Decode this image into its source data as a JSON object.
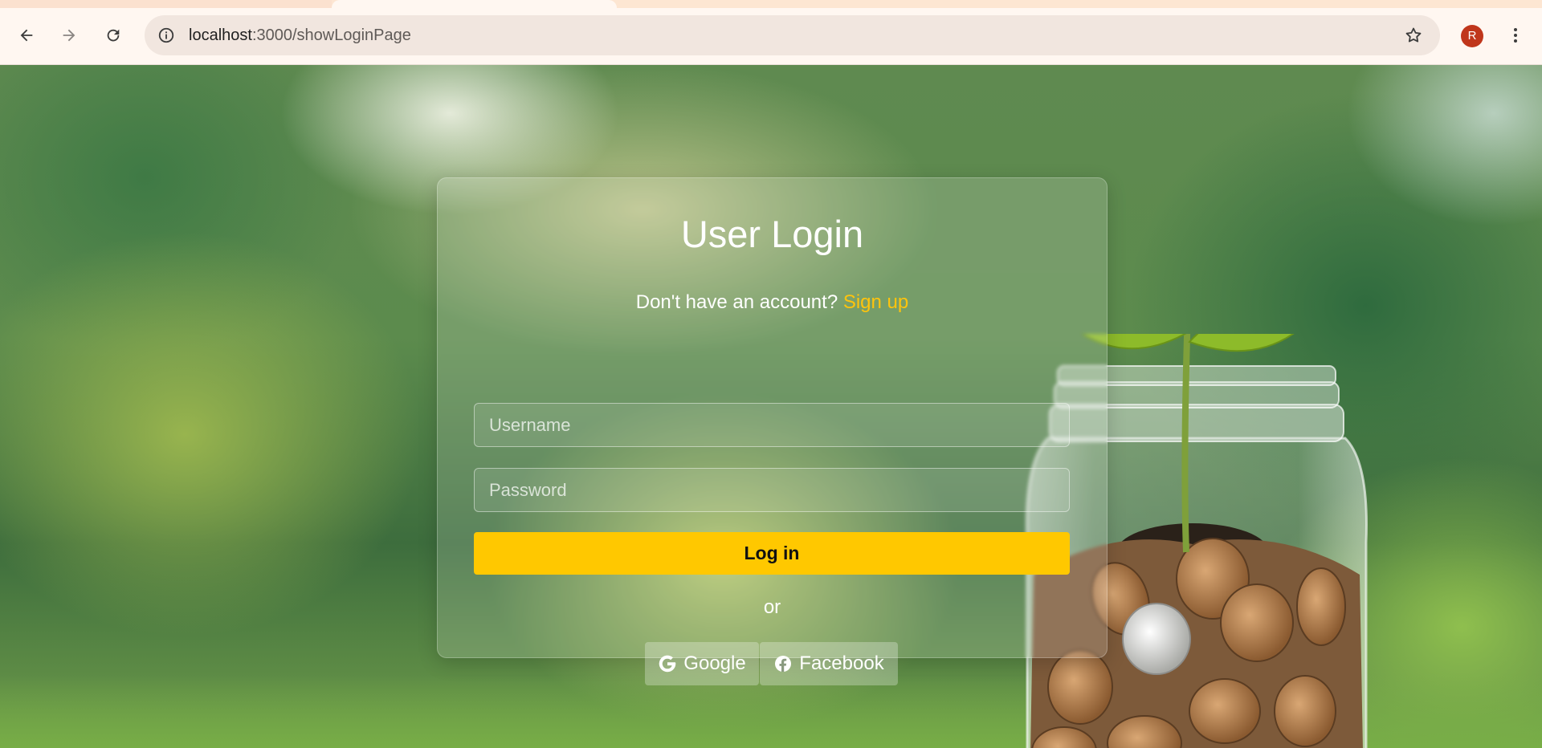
{
  "browser": {
    "address": {
      "host": "localhost",
      "path": ":3000/showLoginPage"
    },
    "profile_initial": "R",
    "icons": {
      "back": "back-arrow-icon",
      "forward": "forward-arrow-icon",
      "reload": "reload-icon",
      "site_info": "info-icon",
      "bookmark": "star-icon",
      "menu": "kebab-menu-icon"
    },
    "colors": {
      "tabstrip": "#fde6d2",
      "toolbar": "#fff7f1",
      "omnibox": "#f1e6df",
      "avatar": "#c0361b"
    }
  },
  "login": {
    "title": "User Login",
    "signup_prompt": "Don't have an account?",
    "signup_link": "Sign up",
    "username_placeholder": "Username",
    "password_placeholder": "Password",
    "login_button": "Log in",
    "or_text": "or",
    "google_label": "Google",
    "facebook_label": "Facebook",
    "colors": {
      "accent": "#ffc800",
      "link": "#ffc40c"
    }
  }
}
